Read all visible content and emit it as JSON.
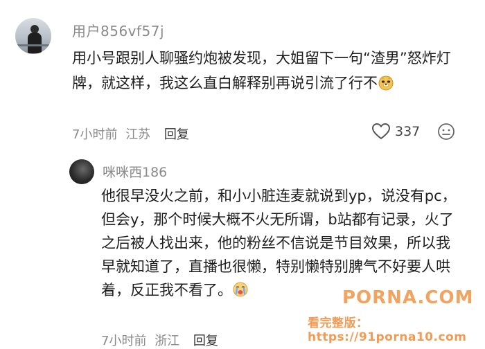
{
  "comment": {
    "username": "用户856vf57j",
    "text_prefix": "用小号跟别人聊骚约炮被发现，大姐留下一句“渣男”怒炸灯牌，就这样，我这么直白解释别再说引流了行不",
    "emoji": "doge-emoji",
    "time": "7小时前",
    "location": "江苏",
    "reply_label": "回复",
    "like_count": "337"
  },
  "sub_comment": {
    "username": "咪咪西186",
    "text_prefix": "他很早没火之前，和小小脏连麦就说到yp，说没有pc，但会y，那个时候大概不火无所谓，b站都有记录，火了之后被人找出来，他的粉丝不信说是节目效果，所以我早就知道了，直播也很懒，特别懒特别脾气不好要人哄着，反正我不看了。",
    "emoji": "crying-emoji",
    "time": "7小时前",
    "location": "浙江",
    "reply_label": "回复"
  },
  "watermark": {
    "brand": "PORNA.COM",
    "line": "看完整版：https://91porna10.com"
  },
  "colors": {
    "meta_gray": "#8a8a8a",
    "text_dark": "#1e1e1e",
    "watermark_orange": "#f2a35f"
  }
}
